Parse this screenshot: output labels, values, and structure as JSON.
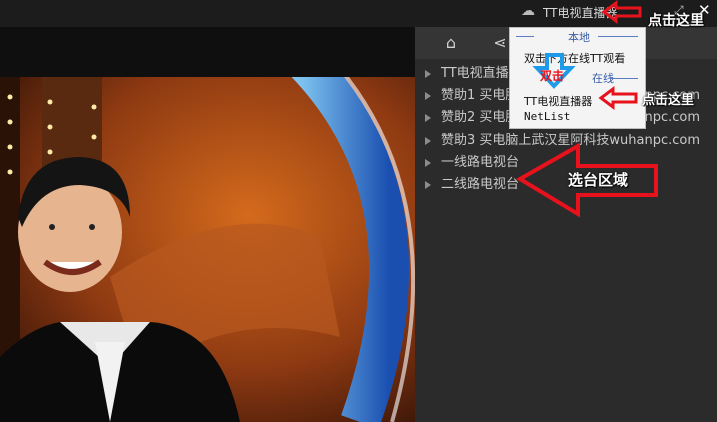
{
  "window": {
    "title": "TT电视直播器",
    "close_icon": "close-icon",
    "cloud_icon": "cloud-icon"
  },
  "panel": {
    "tabs": [
      {
        "icon": "home-icon"
      },
      {
        "icon": "share-icon"
      }
    ],
    "channels": [
      {
        "label": "TT电视直播器"
      },
      {
        "label": "赞助1 买电脑上武汉星阿科技wuhanpc.com"
      },
      {
        "label": "赞助2 买电脑上武汉星阿科技wuhanpc.com"
      },
      {
        "label": "赞助3 买电脑上武汉星阿科技wuhanpc.com"
      },
      {
        "label": "一线路电视台"
      },
      {
        "label": "二线路电视台"
      }
    ]
  },
  "popup": {
    "section_local": "本地",
    "item_online": "双击下方在线TT观看",
    "section_online": "在线",
    "item_tt": "TT电视直播器",
    "item_netlist": "NetList",
    "double_click_label": "双击"
  },
  "annotations": {
    "click_here_top": "点击这里",
    "click_here_mid": "点击这里",
    "select_area": "选台区域"
  },
  "colors": {
    "annotation_red": "#e8121c",
    "arrow_blue": "#1e9be8",
    "panel_bg": "#2b2b2b",
    "popup_bg": "#f4f4f4"
  }
}
